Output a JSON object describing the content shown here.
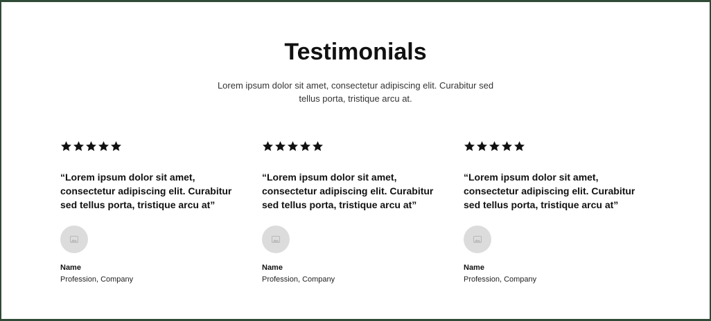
{
  "section": {
    "title": "Testimonials",
    "subtitle": "Lorem ipsum dolor sit amet, consectetur adipiscing elit. Curabitur sed tellus porta, tristique arcu at."
  },
  "testimonials": [
    {
      "rating": 5,
      "quote": "“Lorem ipsum dolor sit amet, consectetur adipiscing elit. Curabitur sed tellus porta, tristique arcu at”",
      "name": "Name",
      "role": "Profession, Company",
      "avatar_icon": "image-placeholder-icon"
    },
    {
      "rating": 5,
      "quote": "“Lorem ipsum dolor sit amet, consectetur adipiscing elit. Curabitur sed tellus porta, tristique arcu at”",
      "name": "Name",
      "role": "Profession, Company",
      "avatar_icon": "image-placeholder-icon"
    },
    {
      "rating": 5,
      "quote": "“Lorem ipsum dolor sit amet, consectetur adipiscing elit. Curabitur sed tellus porta, tristique arcu at”",
      "name": "Name",
      "role": "Profession, Company",
      "avatar_icon": "image-placeholder-icon"
    }
  ],
  "colors": {
    "border": "#2f4a37",
    "background": "#ffffff",
    "text": "#111111",
    "avatar": "#dcdcdc"
  }
}
